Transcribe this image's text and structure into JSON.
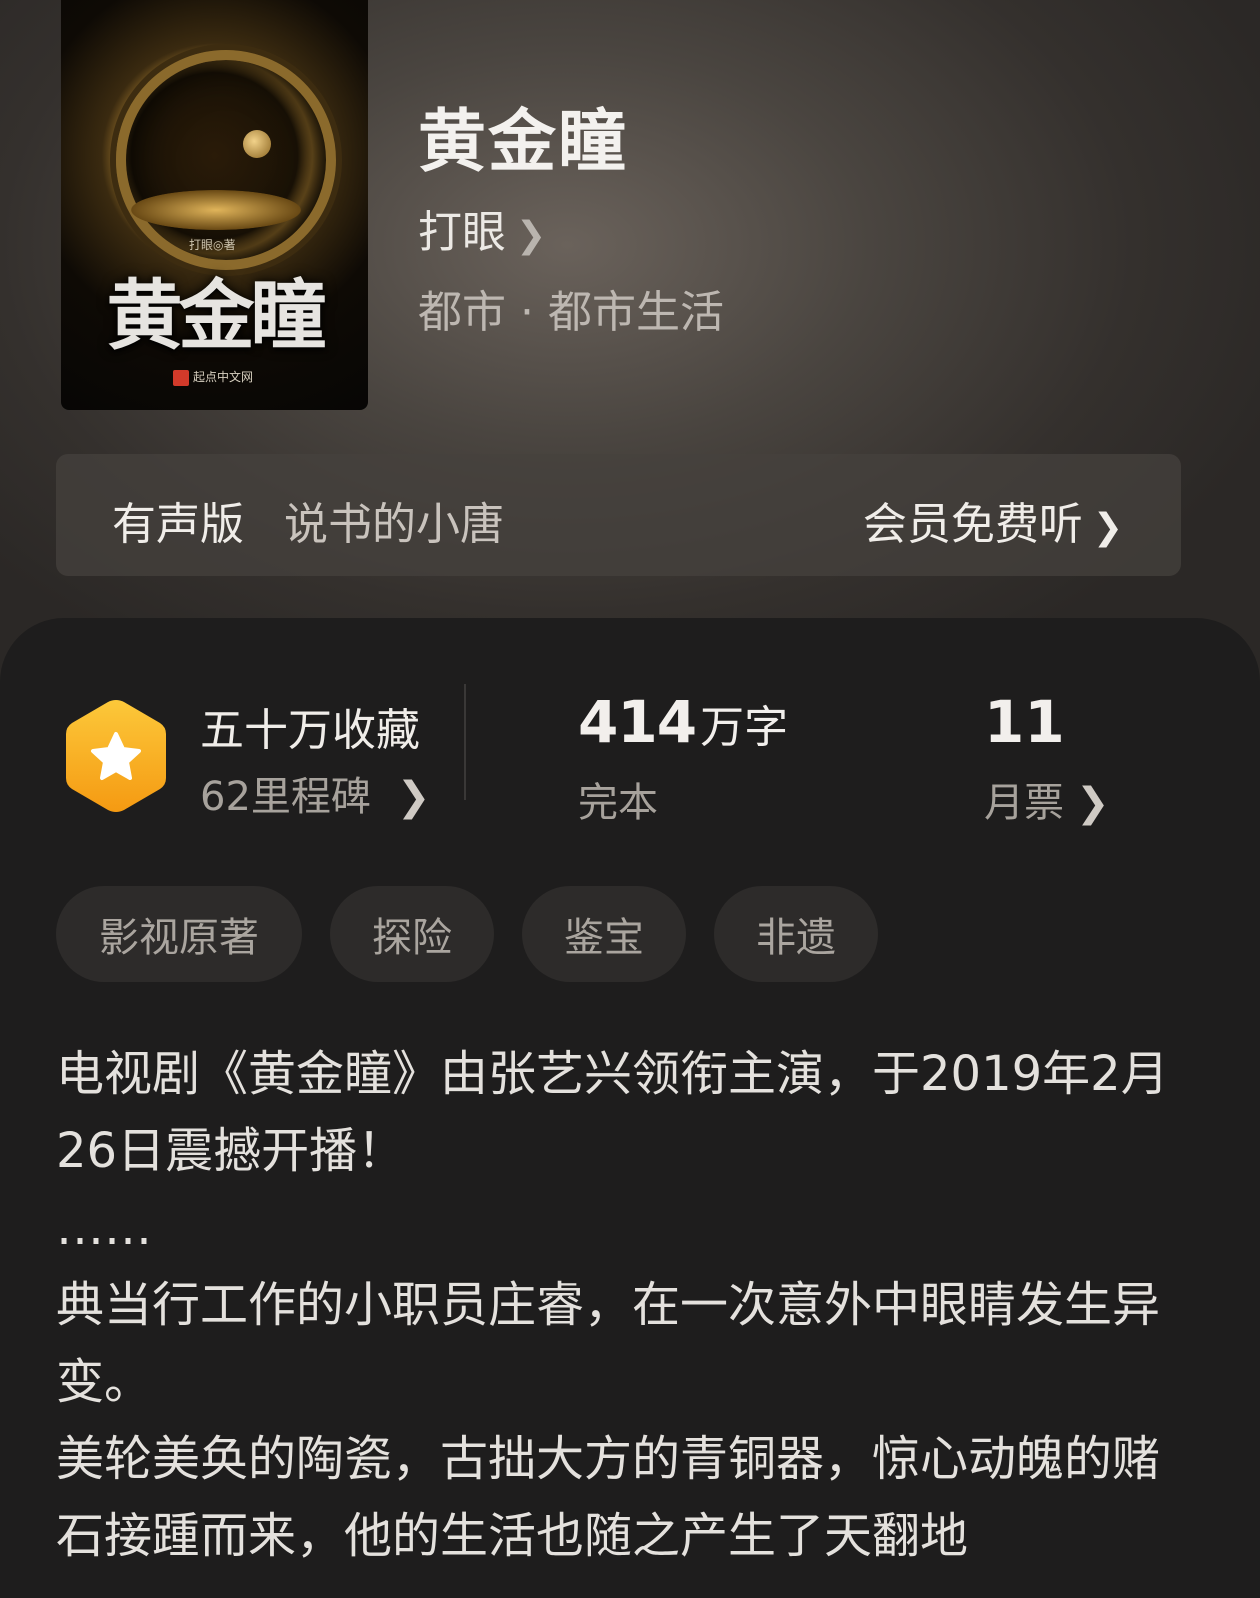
{
  "book": {
    "title": "黄金瞳",
    "author": "打眼",
    "genre": "都市 · 都市生活",
    "cover": {
      "title": "黄金瞳",
      "byline": "打眼◎著",
      "publisher": "起点中文网"
    }
  },
  "audio": {
    "label": "有声版",
    "narrator": "说书的小唐",
    "cta": "会员免费听"
  },
  "stats": {
    "collections": "五十万收藏",
    "milestone": "62里程碑",
    "word_count": "414",
    "word_unit": "万字",
    "status": "完本",
    "monthly_votes": "11",
    "monthly_votes_label": "月票"
  },
  "tags": [
    "影视原著",
    "探险",
    "鉴宝",
    "非遗"
  ],
  "description": [
    "电视剧《黄金瞳》由张艺兴领衔主演，于2019年2月26日震撼开播！",
    "……",
    "典当行工作的小职员庄睿，在一次意外中眼睛发生异变。",
    "美轮美奂的陶瓷，古拙大方的青铜器，惊心动魄的赌石接踵而来，他的生活也随之产生了天翻地"
  ],
  "icons": {
    "chevron": "chevron-right-icon",
    "badge": "star-hexagon-icon"
  },
  "colors": {
    "badge_gold": "#fbbf24",
    "badge_orange": "#f59e0b",
    "background": "#1e1d1d"
  }
}
